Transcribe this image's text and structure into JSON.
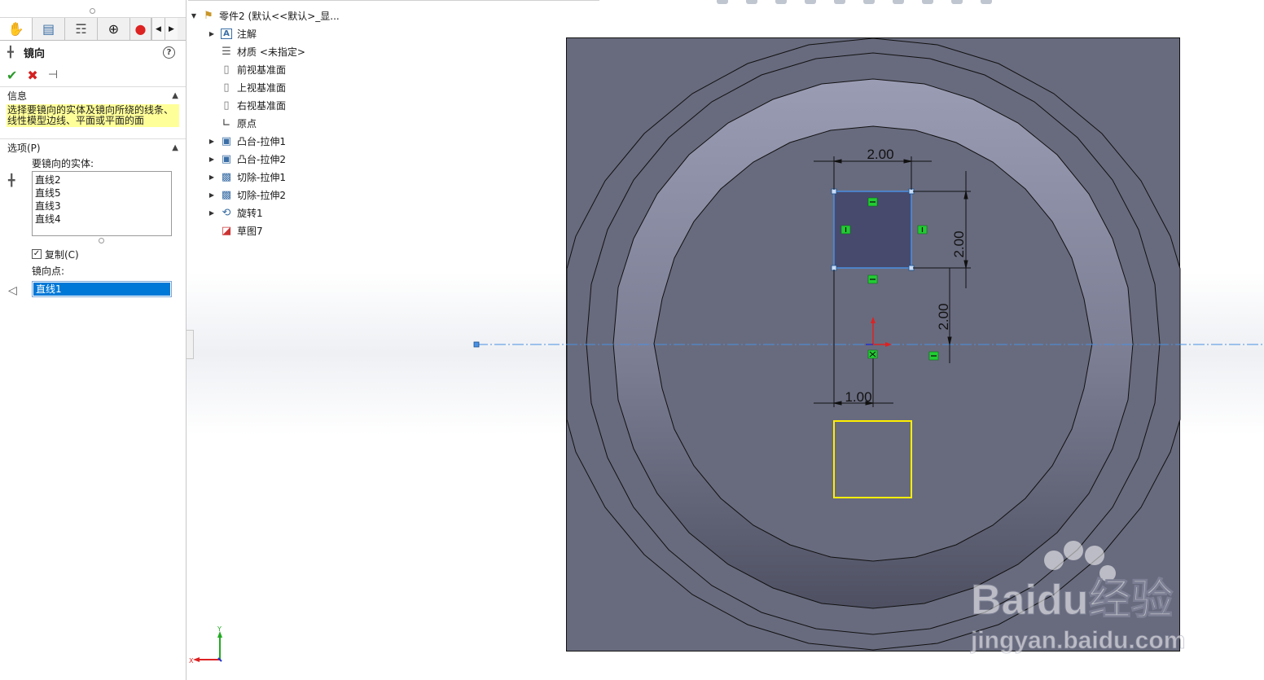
{
  "property_manager": {
    "title": "镜向",
    "help": "?",
    "info_header": "信息",
    "info_text": "选择要镜向的实体及镜向所绕的线条、线性模型边线、平面或平面的面",
    "options_header": "选项(P)",
    "entities_label": "要镜向的实体:",
    "entities": [
      "直线2",
      "直线5",
      "直线3",
      "直线4"
    ],
    "copy_label": "复制(C)",
    "copy_checked": true,
    "mirror_point_label": "镜向点:",
    "mirror_point_value": "直线1"
  },
  "tree": {
    "root": "零件2 (默认<<默认>_显...",
    "items": [
      {
        "label": "注解",
        "icon": "annotation-icon",
        "expandable": true
      },
      {
        "label": "材质 <未指定>",
        "icon": "material-icon",
        "expandable": false
      },
      {
        "label": "前视基准面",
        "icon": "plane-icon",
        "expandable": false
      },
      {
        "label": "上视基准面",
        "icon": "plane-icon",
        "expandable": false
      },
      {
        "label": "右视基准面",
        "icon": "plane-icon",
        "expandable": false
      },
      {
        "label": "原点",
        "icon": "origin-icon",
        "expandable": false
      },
      {
        "label": "凸台-拉伸1",
        "icon": "extrude-icon",
        "expandable": true
      },
      {
        "label": "凸台-拉伸2",
        "icon": "extrude-icon",
        "expandable": true
      },
      {
        "label": "切除-拉伸1",
        "icon": "cut-icon",
        "expandable": true
      },
      {
        "label": "切除-拉伸2",
        "icon": "cut-icon",
        "expandable": true
      },
      {
        "label": "旋转1",
        "icon": "revolve-icon",
        "expandable": true
      },
      {
        "label": "草图7",
        "icon": "sketch-icon",
        "expandable": false
      }
    ]
  },
  "viewport": {
    "dim_top": "2.00",
    "dim_right_upper": "2.00",
    "dim_right_lower": "2.00",
    "dim_bottom": "1.00",
    "axis_x": "X",
    "axis_y": "Y"
  },
  "watermark": {
    "brand": "Baidu经验",
    "url": "jingyan.baidu.com"
  },
  "colors": {
    "accent": "#0078d7",
    "body_face": "#686b7e",
    "ring_light": "#9799b1",
    "sketch_selected": "#4a90e2",
    "sketch_preview": "#ffee00",
    "relation_green": "#22cc33",
    "info_yellow": "#ffff99"
  }
}
